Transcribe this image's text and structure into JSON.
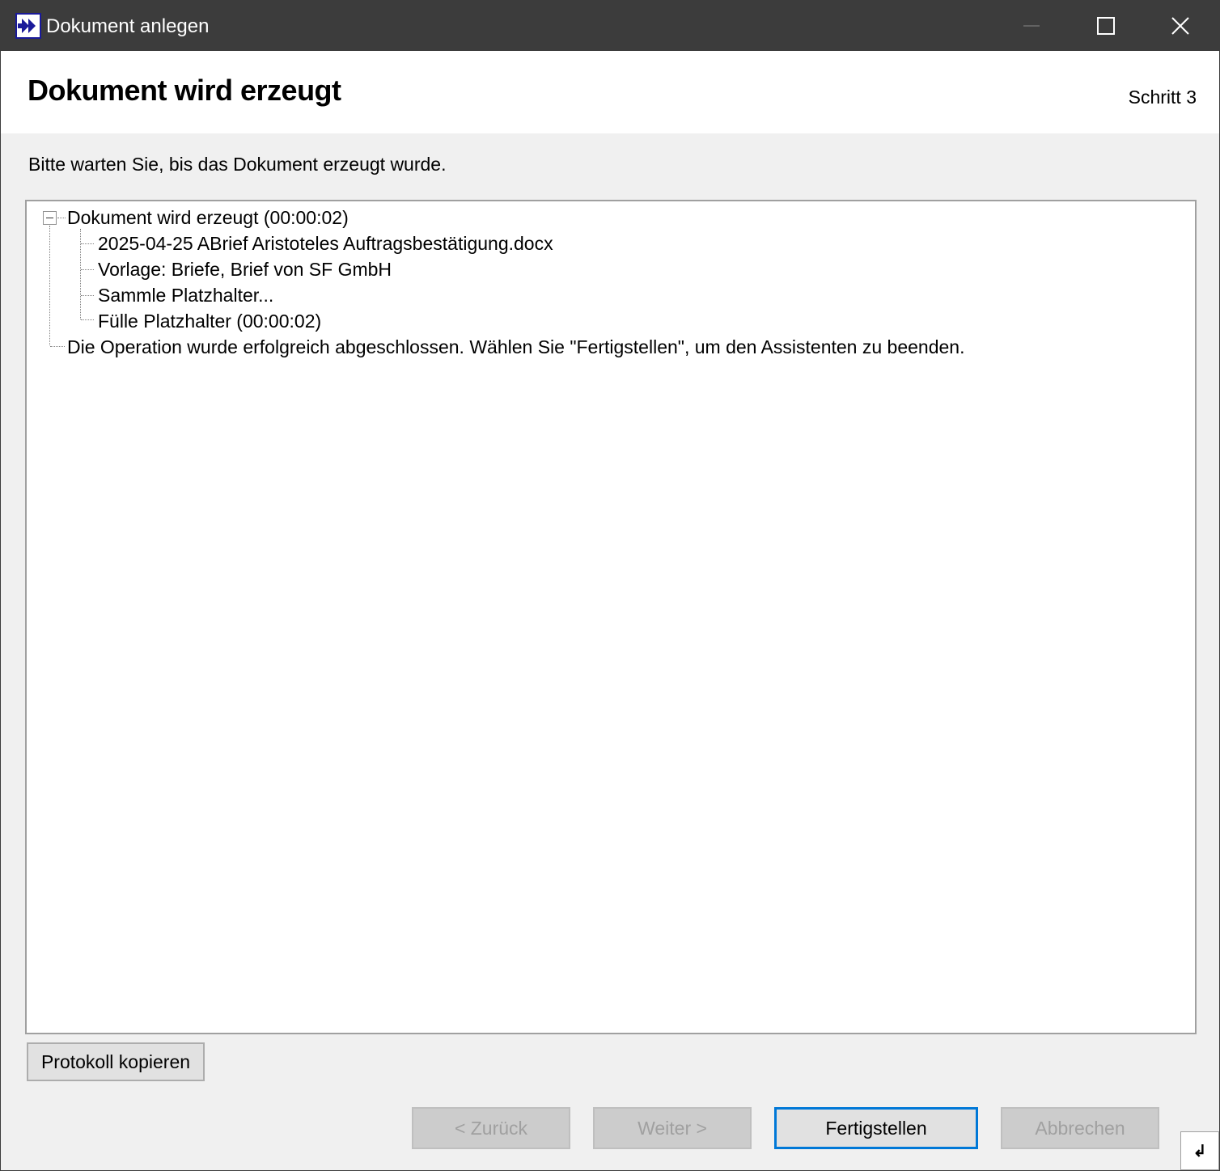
{
  "window": {
    "title": "Dokument anlegen",
    "app_icon": "double-arrow-right-icon",
    "controls": [
      "minimize-icon",
      "maximize-icon",
      "close-icon"
    ]
  },
  "header": {
    "title": "Dokument wird erzeugt",
    "step": "Schritt 3"
  },
  "instruction": "Bitte warten Sie, bis das Dokument erzeugt wurde.",
  "log_tree": {
    "root": {
      "label": "Dokument wird erzeugt (00:00:02)",
      "expanded": true,
      "children": [
        "2025-04-25 ABrief Aristoteles Auftragsbestätigung.docx",
        "Vorlage: Briefe, Brief von SF GmbH",
        "Sammle Platzhalter...",
        "Fülle Platzhalter (00:00:02)"
      ]
    },
    "final_message": "Die Operation wurde erfolgreich abgeschlossen. Wählen Sie \"Fertigstellen\", um den Assistenten zu beenden."
  },
  "buttons": {
    "copy_log": "Protokoll kopieren",
    "back": "< Zurück",
    "next": "Weiter >",
    "finish": "Fertigstellen",
    "cancel": "Abbrechen"
  },
  "colors": {
    "titlebar": "#3c3c3c",
    "default_button_border": "#0078d7",
    "disabled_text": "#a0a0a0"
  }
}
